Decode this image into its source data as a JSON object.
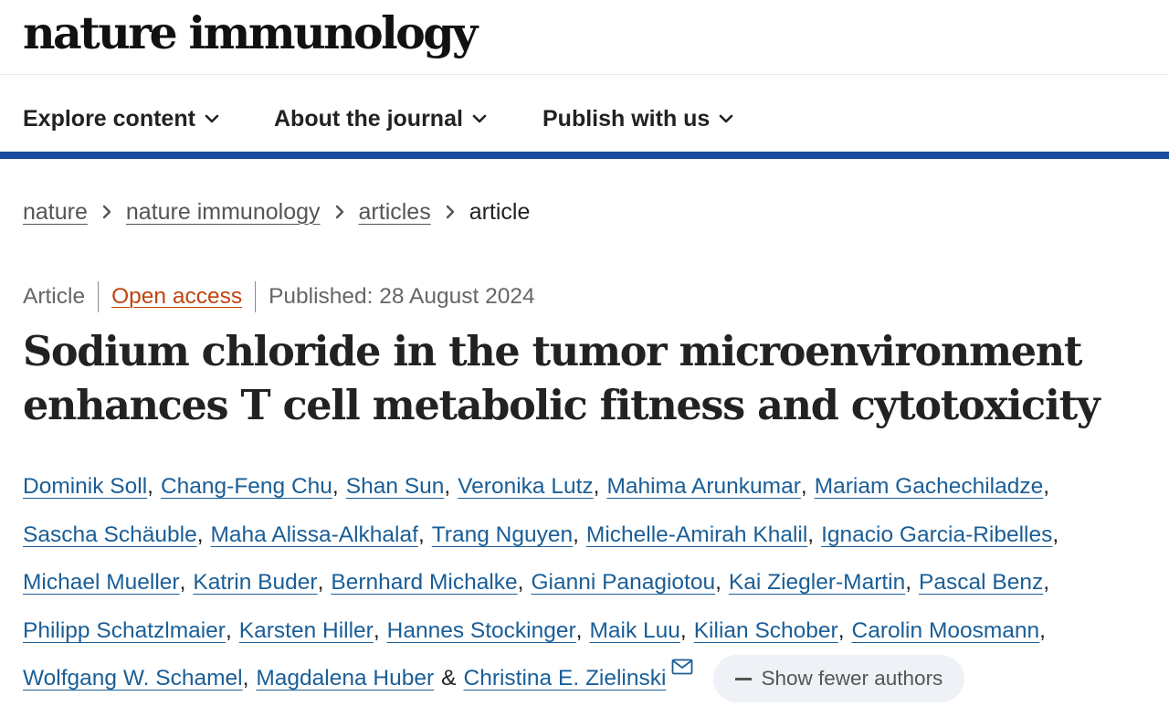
{
  "header": {
    "logo_text": "nature immunology"
  },
  "nav": {
    "items": [
      {
        "label": "Explore content",
        "icon": "chevron-down-icon"
      },
      {
        "label": "About the journal",
        "icon": "chevron-down-icon"
      },
      {
        "label": "Publish with us",
        "icon": "chevron-down-icon"
      }
    ],
    "accent_color": "#1a4b9c"
  },
  "breadcrumb": {
    "items": [
      "nature",
      "nature immunology",
      "articles",
      "article"
    ]
  },
  "article": {
    "type": "Article",
    "access": "Open access",
    "access_color": "#c0440e",
    "published": "Published: 28 August 2024",
    "title_lines": [
      "Sodium chloride in the tumor microenvironment",
      "enhances T cell metabolic fitness and cytotoxicity"
    ]
  },
  "authors": {
    "names": [
      "Dominik Soll",
      "Chang-Feng Chu",
      "Shan Sun",
      "Veronika Lutz",
      "Mahima Arunkumar",
      "Mariam Gachechiladze",
      "Sascha Schäuble",
      "Maha Alissa-Alkhalaf",
      "Trang Nguyen",
      "Michelle-Amirah Khalil",
      "Ignacio Garcia-Ribelles",
      "Michael Mueller",
      "Katrin Buder",
      "Bernhard Michalke",
      "Gianni Panagiotou",
      "Kai Ziegler-Martin",
      "Pascal Benz",
      "Philipp Schatzlmaier",
      "Karsten Hiller",
      "Hannes Stockinger",
      "Maik Luu",
      "Kilian Schober",
      "Carolin Moosmann",
      "Wolfgang W. Schamel",
      "Magdalena Huber",
      "Christina E. Zielinski"
    ],
    "separator": ",",
    "ampersand": "&",
    "show_fewer_label": "Show fewer authors",
    "link_color": "#1a5e97",
    "mail_icon": "envelope-icon"
  }
}
